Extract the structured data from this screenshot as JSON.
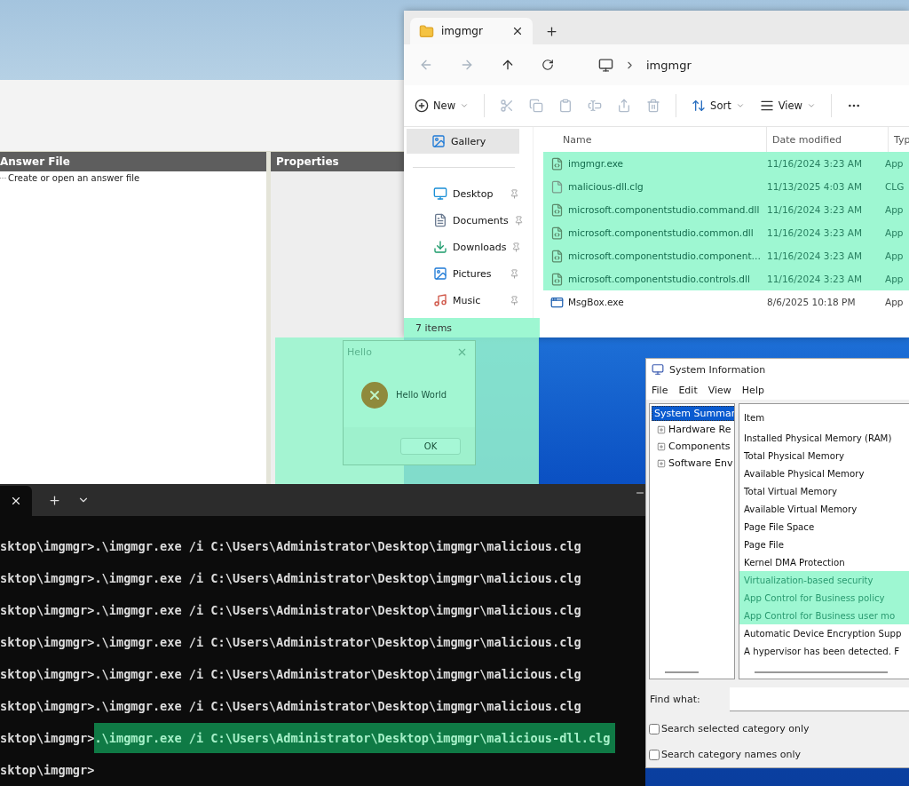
{
  "answer_file_window": {
    "panes": [
      {
        "title": "Answer File",
        "kind": "tree"
      },
      {
        "title": "Properties",
        "kind": "blank"
      }
    ],
    "tree_item": "Create or open an answer file"
  },
  "explorer": {
    "tab_title": "imgmgr",
    "breadcrumb": "imgmgr",
    "commands": [
      {
        "kind": "new",
        "label": "New",
        "disabled": false
      },
      {
        "kind": "cut",
        "disabled": true
      },
      {
        "kind": "copy",
        "disabled": true
      },
      {
        "kind": "paste",
        "disabled": true
      },
      {
        "kind": "rename",
        "disabled": true
      },
      {
        "kind": "share",
        "disabled": true
      },
      {
        "kind": "delete",
        "disabled": true
      },
      {
        "kind": "sort",
        "label": "Sort",
        "disabled": false
      },
      {
        "kind": "view",
        "label": "View",
        "disabled": false
      },
      {
        "kind": "more",
        "disabled": false
      }
    ],
    "sidebar": [
      {
        "kind": "gallery",
        "label": "Gallery",
        "selected": true,
        "pinned": false
      },
      {
        "kind": "desktop",
        "label": "Desktop",
        "selected": false,
        "pinned": true
      },
      {
        "kind": "documents",
        "label": "Documents",
        "selected": false,
        "pinned": true
      },
      {
        "kind": "downloads",
        "label": "Downloads",
        "selected": false,
        "pinned": true
      },
      {
        "kind": "pictures",
        "label": "Pictures",
        "selected": false,
        "pinned": true
      },
      {
        "kind": "music",
        "label": "Music",
        "selected": false,
        "pinned": true
      }
    ],
    "columns": [
      "Name",
      "Date modified",
      "Typ"
    ],
    "rows": [
      {
        "kind": "exe",
        "name": "imgmgr.exe",
        "date": "11/16/2024 3:23 AM",
        "type": "App",
        "highlighted": true
      },
      {
        "kind": "file",
        "name": "malicious-dll.clg",
        "date": "11/13/2025 4:03 AM",
        "type": "CLG",
        "highlighted": true
      },
      {
        "kind": "dll",
        "name": "microsoft.componentstudio.command.dll",
        "date": "11/16/2024 3:23 AM",
        "type": "App",
        "highlighted": true
      },
      {
        "kind": "dll",
        "name": "microsoft.componentstudio.common.dll",
        "date": "11/16/2024 3:23 AM",
        "type": "App",
        "highlighted": true
      },
      {
        "kind": "dll",
        "name": "microsoft.componentstudio.component…",
        "date": "11/16/2024 3:23 AM",
        "type": "App",
        "highlighted": true
      },
      {
        "kind": "dll",
        "name": "microsoft.componentstudio.controls.dll",
        "date": "11/16/2024 3:23 AM",
        "type": "App",
        "highlighted": true
      },
      {
        "kind": "app",
        "name": "MsgBox.exe",
        "date": "8/6/2025 10:18 PM",
        "type": "App",
        "highlighted": false
      }
    ],
    "status": "7 items",
    "status_highlighted": true
  },
  "hello_dialog": {
    "title": "Hello",
    "message": "Hello World",
    "button": "OK",
    "highlighted": true
  },
  "system_information": {
    "title": "System Information",
    "menu": [
      "File",
      "Edit",
      "View",
      "Help"
    ],
    "tree": [
      {
        "label": "System Summar",
        "selected": true,
        "children": [
          {
            "label": "Hardware Re"
          },
          {
            "label": "Components"
          },
          {
            "label": "Software Env"
          }
        ]
      }
    ],
    "header": "Item",
    "items": [
      {
        "label": "Installed Physical Memory (RAM)",
        "highlighted": false
      },
      {
        "label": "Total Physical Memory",
        "highlighted": false
      },
      {
        "label": "Available Physical Memory",
        "highlighted": false
      },
      {
        "label": "Total Virtual Memory",
        "highlighted": false
      },
      {
        "label": "Available Virtual Memory",
        "highlighted": false
      },
      {
        "label": "Page File Space",
        "highlighted": false
      },
      {
        "label": "Page File",
        "highlighted": false
      },
      {
        "label": "Kernel DMA Protection",
        "highlighted": false
      },
      {
        "label": "Virtualization-based security",
        "highlighted": true
      },
      {
        "label": "App Control for Business policy",
        "highlighted": true
      },
      {
        "label": "App Control for Business user mo",
        "highlighted": true
      },
      {
        "label": "Automatic Device Encryption Supp",
        "highlighted": false
      },
      {
        "label": "A hypervisor has been detected. F",
        "highlighted": false
      }
    ],
    "find_label": "Find what:",
    "checkboxes": [
      {
        "label": "Search selected category only",
        "checked": false
      },
      {
        "label": "Search category names only",
        "checked": false
      }
    ]
  },
  "terminal": {
    "lines": [
      {
        "prompt": "sktop\\imgmgr>",
        "command": ".\\imgmgr.exe /i C:\\Users\\Administrator\\Desktop\\imgmgr\\malicious.clg",
        "highlighted": false
      },
      {
        "prompt": "sktop\\imgmgr>",
        "command": ".\\imgmgr.exe /i C:\\Users\\Administrator\\Desktop\\imgmgr\\malicious.clg",
        "highlighted": false
      },
      {
        "prompt": "sktop\\imgmgr>",
        "command": ".\\imgmgr.exe /i C:\\Users\\Administrator\\Desktop\\imgmgr\\malicious.clg",
        "highlighted": false
      },
      {
        "prompt": "sktop\\imgmgr>",
        "command": ".\\imgmgr.exe /i C:\\Users\\Administrator\\Desktop\\imgmgr\\malicious.clg",
        "highlighted": false
      },
      {
        "prompt": "sktop\\imgmgr>",
        "command": ".\\imgmgr.exe /i C:\\Users\\Administrator\\Desktop\\imgmgr\\malicious.clg",
        "highlighted": false
      },
      {
        "prompt": "sktop\\imgmgr>",
        "command": ".\\imgmgr.exe /i C:\\Users\\Administrator\\Desktop\\imgmgr\\malicious.clg",
        "highlighted": false
      },
      {
        "prompt": "sktop\\imgmgr>",
        "command": ".\\imgmgr.exe /i C:\\Users\\Administrator\\Desktop\\imgmgr\\malicious-dll.clg",
        "highlighted": true
      },
      {
        "prompt": "sktop\\imgmgr>"
      }
    ]
  }
}
